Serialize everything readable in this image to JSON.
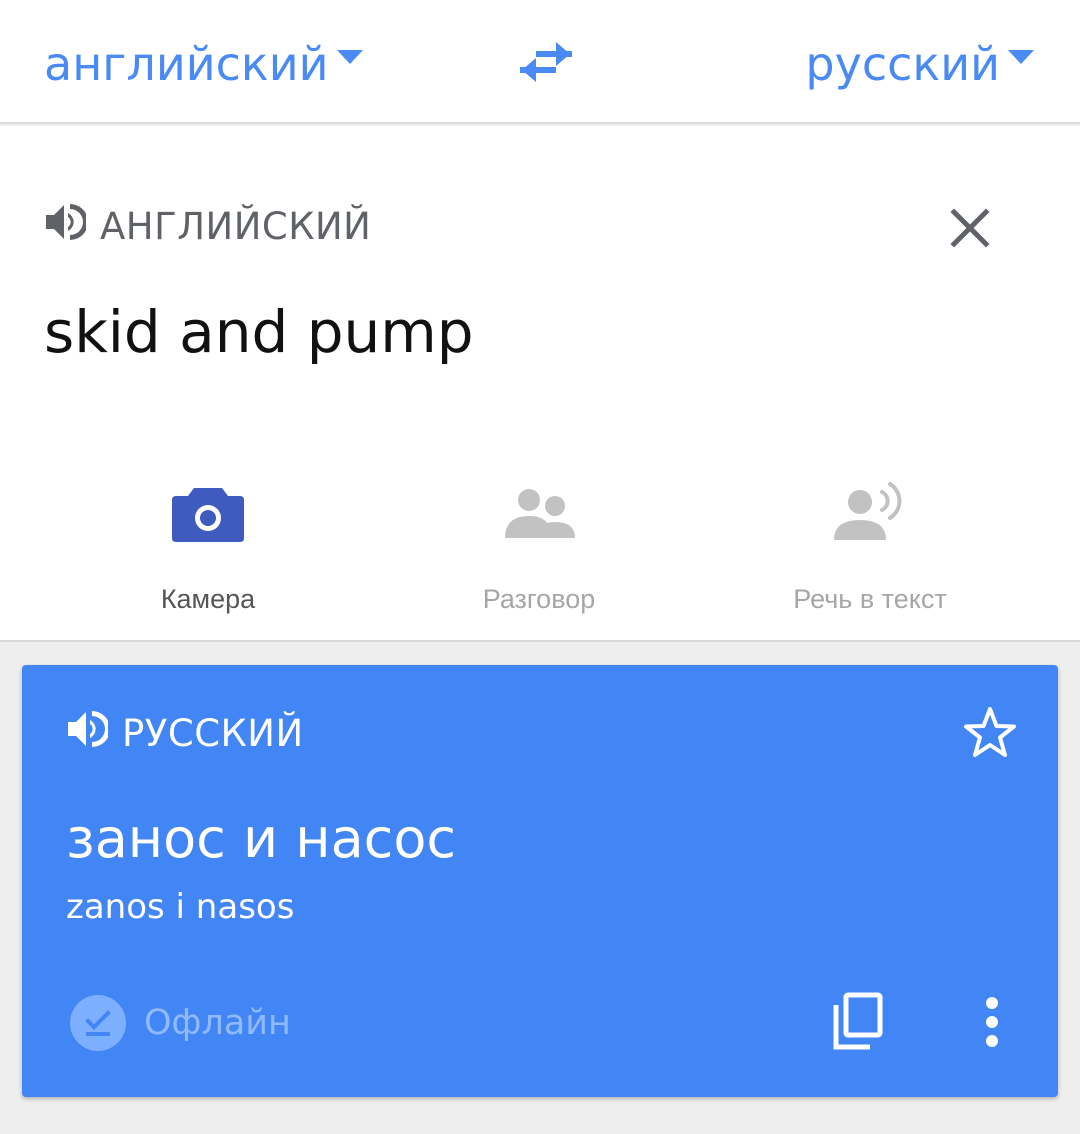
{
  "header": {
    "source_language": "английский",
    "target_language": "русский"
  },
  "input": {
    "language_label": "АНГЛИЙСКИЙ",
    "text": "skid and pump"
  },
  "tools": [
    {
      "label": "Камера",
      "icon": "camera-icon"
    },
    {
      "label": "Разговор",
      "icon": "people-icon"
    },
    {
      "label": "Речь в текст",
      "icon": "speech-icon"
    }
  ],
  "result": {
    "language_label": "РУССКИЙ",
    "text": "занос и насос",
    "transliteration": "zanos i nasos",
    "offline_label": "Офлайн"
  },
  "colors": {
    "accent": "#4285f4",
    "link": "#4a8af4",
    "camera_icon": "#3f5bbf"
  }
}
